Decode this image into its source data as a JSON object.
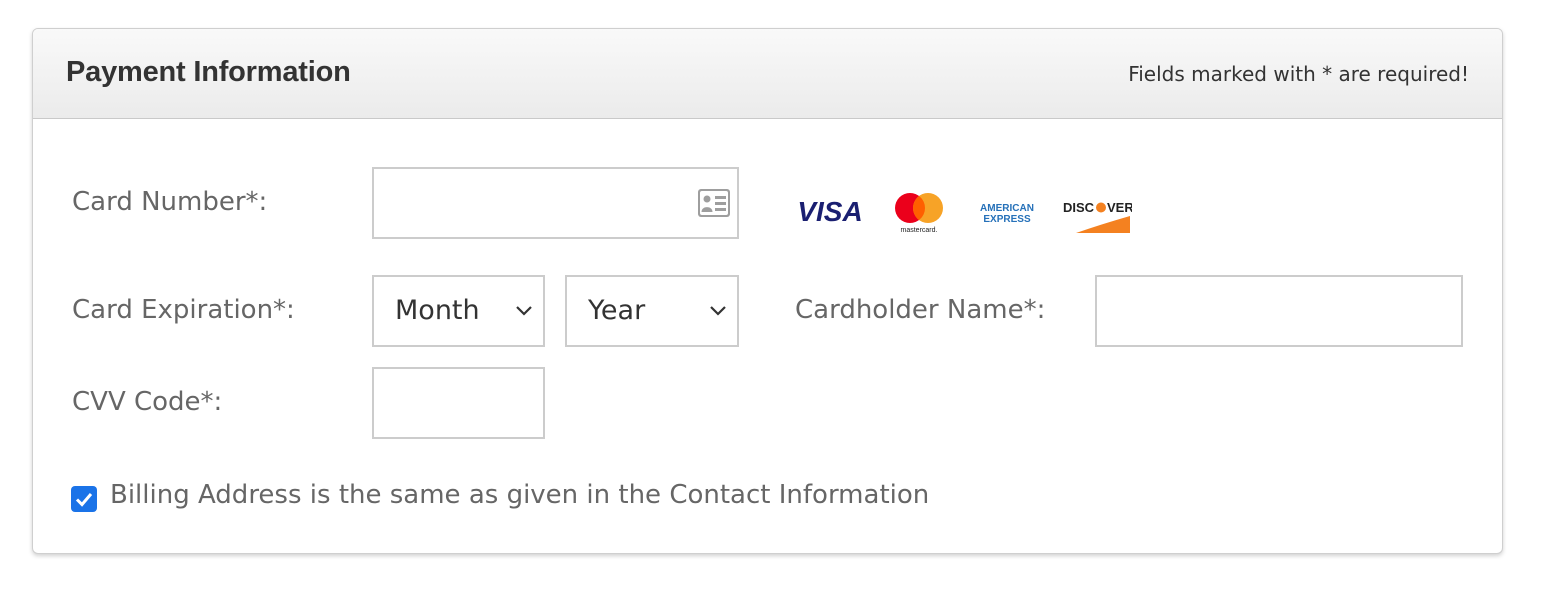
{
  "header": {
    "title": "Payment Information",
    "required_note": "Fields marked with * are required!"
  },
  "card_number": {
    "label": "Card Number*:",
    "value": "",
    "icon": "id-card-icon"
  },
  "card_logos": {
    "visa": "VISA",
    "mastercard": "mastercard.",
    "amex_line1": "AMERICAN",
    "amex_line2": "EXPRESS",
    "discover_left": "DISC",
    "discover_right": "VER"
  },
  "expiration": {
    "label": "Card Expiration*:",
    "month": "Month",
    "year": "Year"
  },
  "cardholder": {
    "label": "Cardholder Name*:",
    "value": ""
  },
  "cvv": {
    "label": "CVV Code*:",
    "value": ""
  },
  "billing": {
    "checked": true,
    "label": "Billing Address is the same as given in the Contact Information"
  },
  "colors": {
    "accent": "#1a73e8",
    "visa": "#1a1f71",
    "mc_red": "#eb001b",
    "mc_orange": "#f79e1b",
    "amex": "#2671b9",
    "discover_orange": "#f48120"
  }
}
